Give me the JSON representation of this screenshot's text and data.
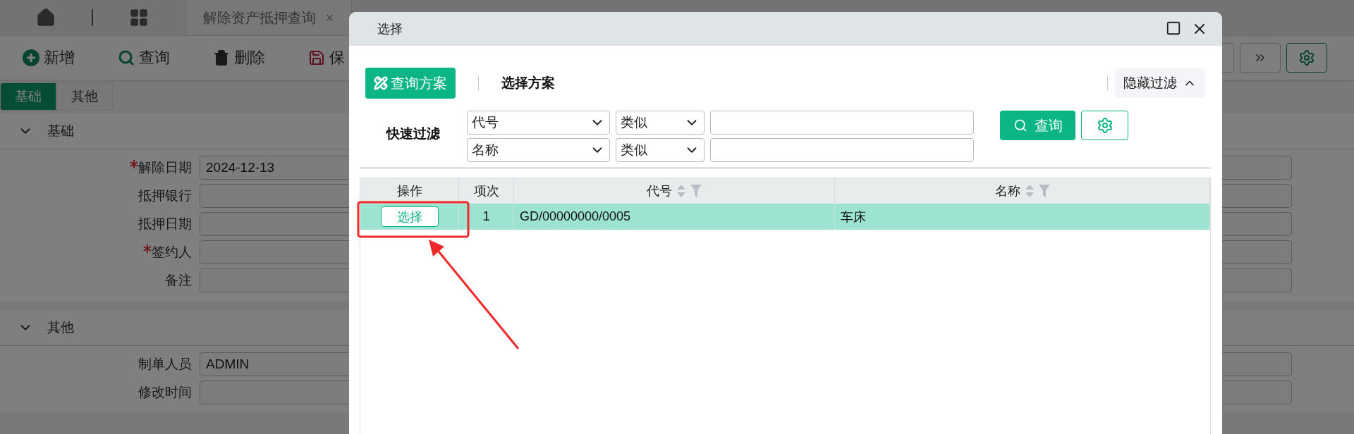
{
  "top_tabs": [
    {
      "label": "解除资产抵押查询",
      "close": "×"
    }
  ],
  "toolbar": [
    {
      "label": "新增",
      "kind": "add"
    },
    {
      "label": "查询",
      "kind": "search"
    },
    {
      "label": "删除",
      "kind": "delete"
    },
    {
      "label": "保",
      "kind": "save"
    }
  ],
  "form_tabs": [
    {
      "label": "基础",
      "selected": true
    },
    {
      "label": "其他",
      "selected": false
    }
  ],
  "sections": [
    {
      "title": "基础",
      "expanded": true,
      "fields": [
        {
          "label": "解除日期",
          "required": true,
          "value": "2024-12-13"
        },
        {
          "label": "抵押银行"
        },
        {
          "label": "抵押日期"
        },
        {
          "label": "签约人",
          "required": true
        },
        {
          "label": "备注"
        }
      ]
    },
    {
      "title": "其他",
      "expanded": true,
      "fields": [
        {
          "label": "制单人员",
          "value": "ADMIN"
        },
        {
          "label": "修改时间"
        }
      ]
    }
  ],
  "dialog": {
    "title": "选择",
    "scheme_button": "查询方案",
    "scheme_label": "选择方案",
    "hide_filter": "隐藏过滤",
    "quick_filter": {
      "label": "快速过滤",
      "rows": [
        {
          "field": "代号",
          "operator": "类似"
        },
        {
          "field": "名称",
          "operator": "类似"
        }
      ]
    },
    "search_button": "查询",
    "table": {
      "columns": [
        {
          "label": "操作"
        },
        {
          "label": "项次"
        },
        {
          "label": "代号",
          "sortable": true
        },
        {
          "label": "名称",
          "sortable": true
        }
      ],
      "rows": [
        {
          "selected": true,
          "action": "选择",
          "index": "1",
          "code": "GD/00000000/0005",
          "name": "车床"
        }
      ]
    }
  }
}
